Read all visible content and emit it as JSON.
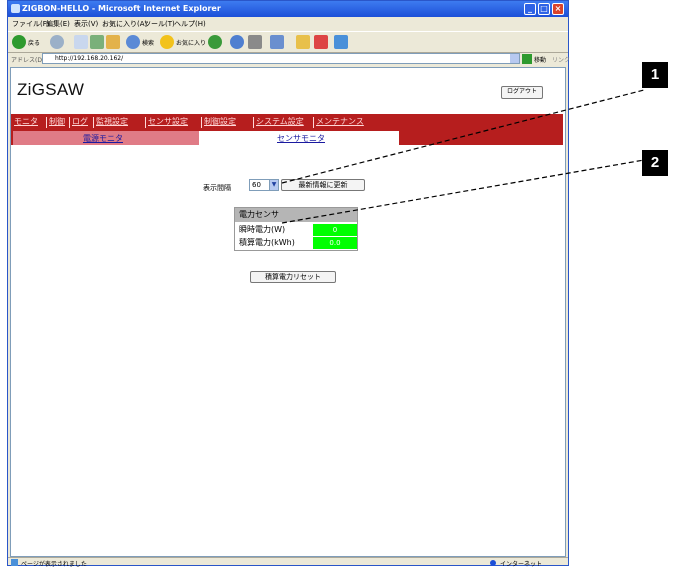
{
  "window": {
    "title": "ZIGBON-HELLO - Microsoft Internet Explorer"
  },
  "menu": [
    "ファイル(F)",
    "編集(E)",
    "表示(V)",
    "お気に入り(A)",
    "ツール(T)",
    "ヘルプ(H)"
  ],
  "toolbar": {
    "back_label": "戻る",
    "search_label": "検索",
    "favorites_label": "お気に入り"
  },
  "address": {
    "label": "アドレス(D)",
    "url": "http://192.168.20.162/",
    "go_label": "移動",
    "links_label": "リンク"
  },
  "page": {
    "logo": "ZiGSAW",
    "logout": "ログアウト",
    "nav": [
      "モニタ",
      "制御",
      "ログ",
      "監視設定",
      "センサ設定",
      "制御設定",
      "システム設定",
      "メンテナンス"
    ],
    "subtabs": [
      "電源モニタ",
      "センサモニタ"
    ],
    "interval_label": "表示間隔",
    "interval_value": "60",
    "refresh_button": "最新情報に更新",
    "sensor_title": "電力センサ",
    "rows": [
      {
        "label": "瞬時電力(W)",
        "value": "0"
      },
      {
        "label": "積算電力(kWh)",
        "value": "0.0"
      }
    ],
    "reset_button": "積算電力リセット"
  },
  "status": {
    "text": "ページが表示されました",
    "zone": "インターネット"
  },
  "callouts": [
    "1",
    "2"
  ]
}
